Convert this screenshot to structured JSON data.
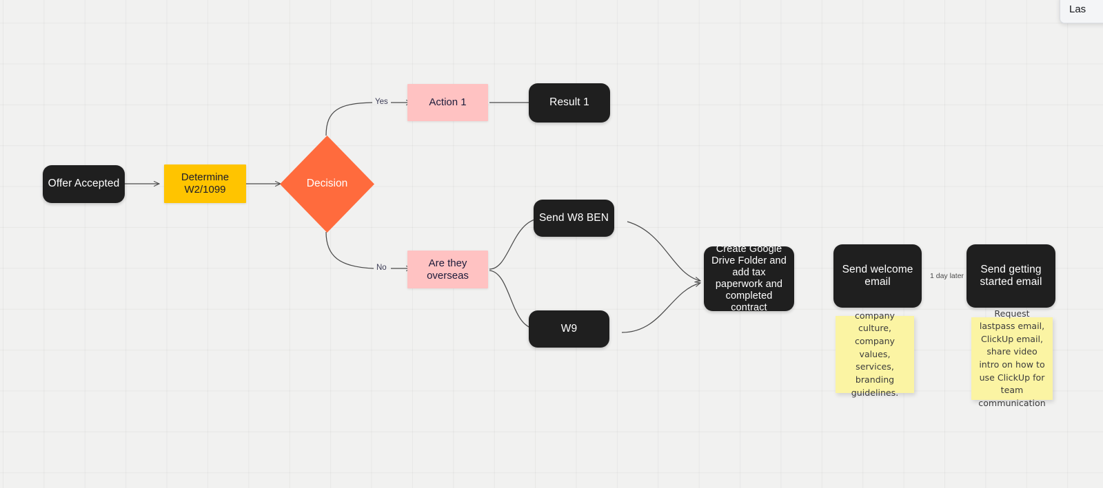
{
  "canvas": {
    "background_color": "#f1f1f0",
    "grid_color": "#e6e6e5",
    "grid_size": 59
  },
  "palette": {
    "dark": "#1f1f1f",
    "yellow": "#ffc400",
    "orange": "#ff6b3d",
    "pink": "#ffc2c2",
    "sticky_yellow": "#fbf4a3",
    "edge": "#4a4a4a",
    "text_on_dark": "#ffffff",
    "text_on_light": "#1b1b3a"
  },
  "nodes": {
    "offer_accepted": {
      "label": "Offer Accepted",
      "shape": "rounded-rect",
      "color": "#1f1f1f"
    },
    "determine_w2_1099": {
      "label": "Determine\nW2/1099",
      "line1": "Determine",
      "line2": "W2/1099",
      "shape": "rect",
      "color": "#ffc400"
    },
    "decision": {
      "label": "Decision",
      "shape": "diamond",
      "color": "#ff6b3d"
    },
    "action_1": {
      "label": "Action 1",
      "shape": "rect",
      "color": "#ffc2c2"
    },
    "result_1": {
      "label": "Result 1",
      "shape": "rounded-rect",
      "color": "#1f1f1f"
    },
    "are_they_overseas": {
      "label": "Are they\noverseas",
      "line1": "Are they",
      "line2": "overseas",
      "shape": "rect",
      "color": "#ffc2c2"
    },
    "send_w8_ben": {
      "label": "Send W8 BEN",
      "shape": "rounded-rect",
      "color": "#1f1f1f"
    },
    "w9": {
      "label": "W9",
      "shape": "rounded-rect",
      "color": "#1f1f1f"
    },
    "create_drive_folder": {
      "label": "Create Google Drive Folder and add tax paperwork and completed contract",
      "shape": "rounded-rect",
      "color": "#1f1f1f"
    },
    "send_welcome_email": {
      "label": "Send welcome email",
      "shape": "rounded-rect",
      "color": "#1f1f1f"
    },
    "send_getting_started_email": {
      "label": "Send getting started email",
      "shape": "rounded-rect",
      "color": "#1f1f1f"
    }
  },
  "edge_labels": {
    "yes": "Yes",
    "no": "No",
    "one_day_later": "1 day later"
  },
  "sticky_notes": {
    "welcome_note": "company culture, company values, services, branding guidelines.",
    "getting_started_note": "Request lastpass email, ClickUp email, share video intro on how to use ClickUp for team communication"
  },
  "side_panel": {
    "text": "Las"
  }
}
